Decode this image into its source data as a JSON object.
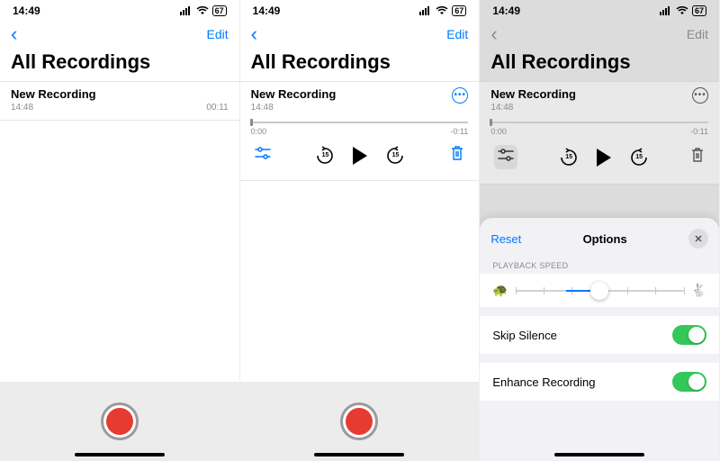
{
  "status": {
    "time": "14:49",
    "battery": "67"
  },
  "nav": {
    "edit": "Edit"
  },
  "title": "All Recordings",
  "recording": {
    "name": "New Recording",
    "time": "14:48",
    "duration": "00:11"
  },
  "scrubber": {
    "current": "0:00",
    "remaining": "-0:11"
  },
  "skip": {
    "amount_back": "15",
    "amount_fwd": "15"
  },
  "sheet": {
    "reset": "Reset",
    "title": "Options",
    "section_speed": "PLAYBACK SPEED",
    "skip_silence": "Skip Silence",
    "enhance": "Enhance Recording",
    "skip_silence_on": true,
    "enhance_on": true
  }
}
